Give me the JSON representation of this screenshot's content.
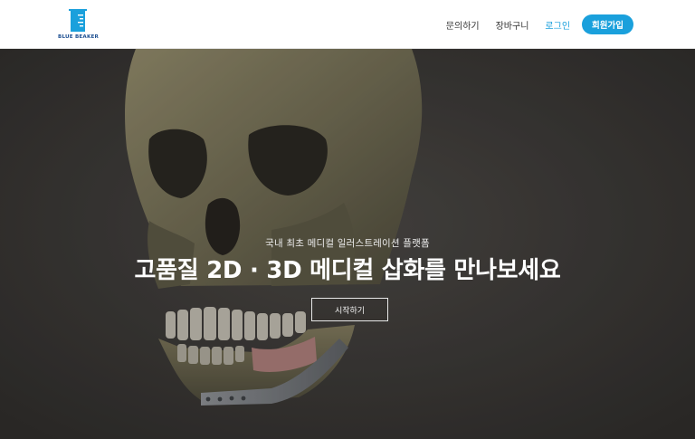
{
  "brand": {
    "name": "BLUE BEAKER",
    "logo_icon": "beaker-icon",
    "color": "#1aa0dc"
  },
  "nav": {
    "inquiry": "문의하기",
    "cart": "장바구니",
    "login": "로그인",
    "signup": "회원가입"
  },
  "hero": {
    "subtitle": "국내 최초 메디컬 일러스트레이션 플랫폼",
    "title": "고품질 2D · 3D 메디컬 삽화를 만나보세요",
    "cta": "시작하기",
    "image": "skull-illustration"
  },
  "colors": {
    "accent": "#1aa0dc",
    "hero_bg": "#3b3936"
  }
}
